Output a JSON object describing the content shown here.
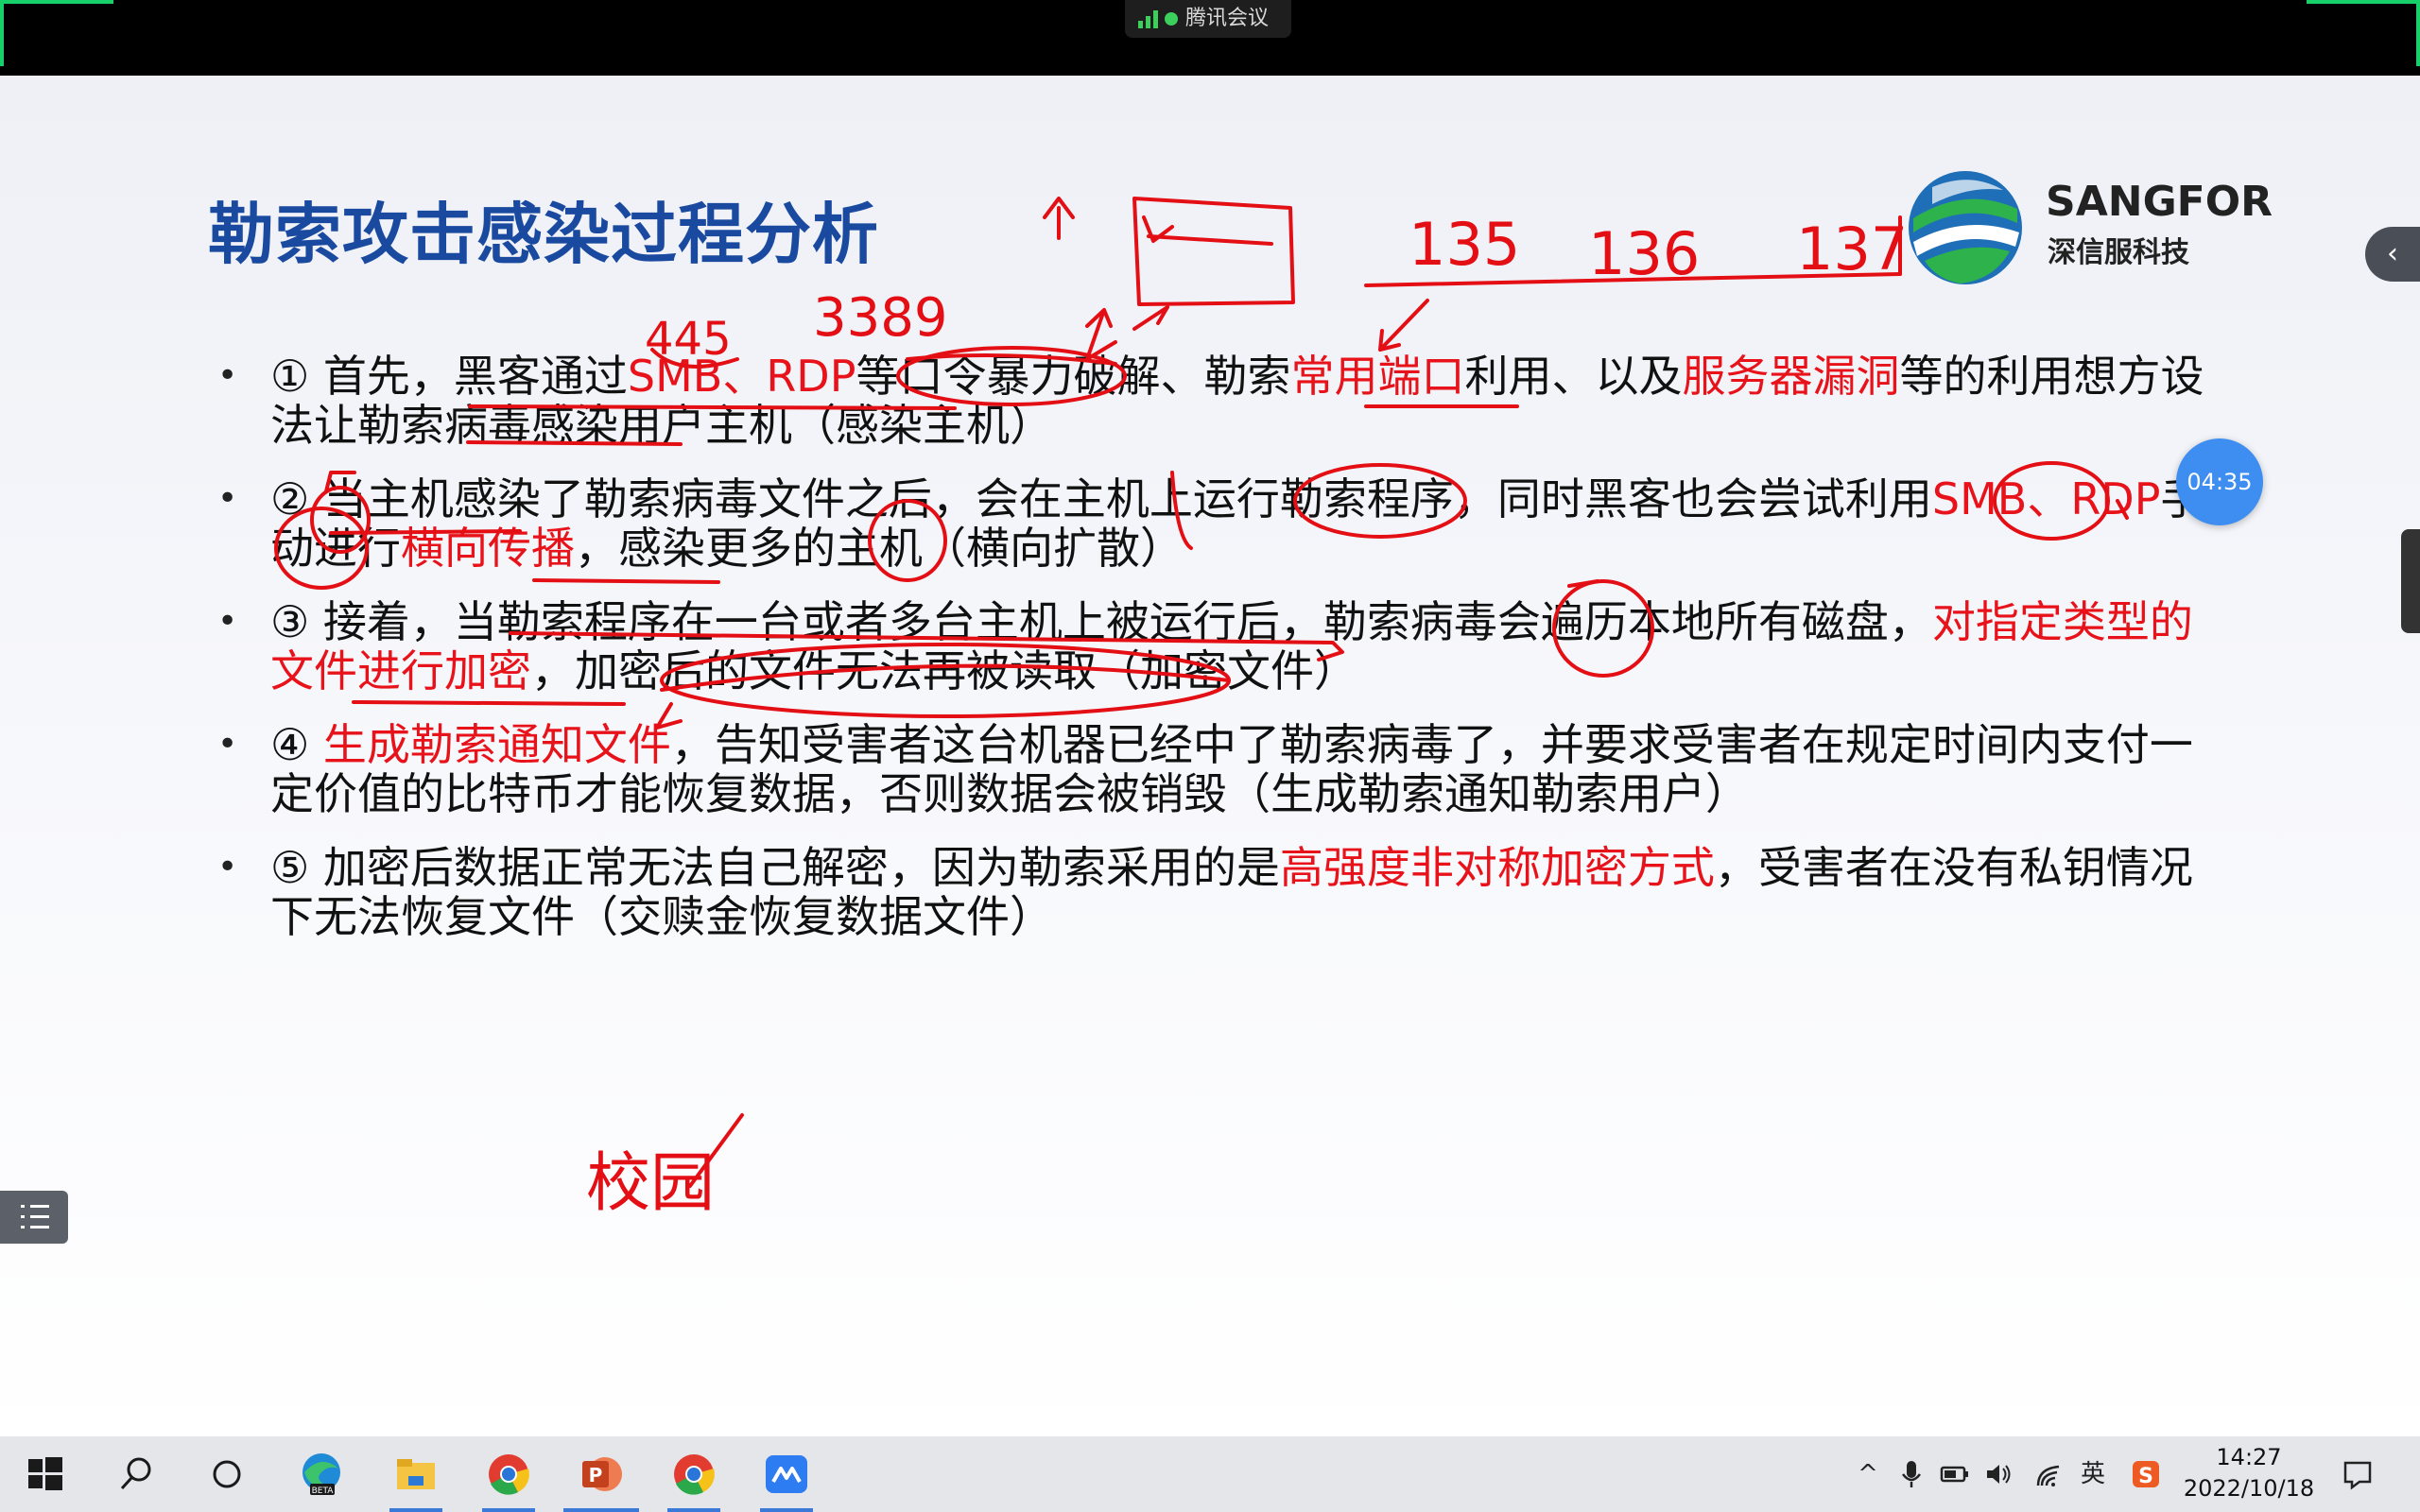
{
  "meeting": {
    "app_name": "腾讯会议"
  },
  "slide": {
    "title": "勒索攻击感染过程分析",
    "logo": {
      "brand": "SANGFOR",
      "brand_cn": "深信服科技"
    },
    "bullets": [
      {
        "parts": [
          {
            "t": "① 首先，黑客通过",
            "c": "black"
          },
          {
            "t": "SMB、RDP",
            "c": "red"
          },
          {
            "t": "等口令暴力破解、勒索",
            "c": "black"
          },
          {
            "t": "常用端口",
            "c": "red"
          },
          {
            "t": "利用、以及",
            "c": "black"
          },
          {
            "t": "服务器漏洞",
            "c": "red"
          },
          {
            "t": "等的利用想方设法让勒索病毒感染用户主机（感染主机）",
            "c": "black"
          }
        ]
      },
      {
        "parts": [
          {
            "t": "② 当主机感染了勒索病毒文件之后，会在主机上运行勒索程序，同时黑客也会尝试利用",
            "c": "black"
          },
          {
            "t": "SMB、RDP",
            "c": "red"
          },
          {
            "t": "手动进行",
            "c": "black"
          },
          {
            "t": "横向传播",
            "c": "red"
          },
          {
            "t": "，感染更多的主机（横向扩散）",
            "c": "black"
          }
        ]
      },
      {
        "parts": [
          {
            "t": "③ 接着，当勒索程序在一台或者多台主机上被运行后，勒索病毒会遍历本地所有磁盘，",
            "c": "black"
          },
          {
            "t": "对指定类型的文件进行加密",
            "c": "red"
          },
          {
            "t": "，加密后的文件无法再被读取（加密文件）",
            "c": "black"
          }
        ]
      },
      {
        "parts": [
          {
            "t": "④ ",
            "c": "black"
          },
          {
            "t": "生成勒索通知文件",
            "c": "red"
          },
          {
            "t": "，告知受害者这台机器已经中了勒索病毒了，并要求受害者在规定时间内支付一定价值的比特币才能恢复数据，否则数据会被销毁（生成勒索通知勒索用户）",
            "c": "black"
          }
        ]
      },
      {
        "parts": [
          {
            "t": "⑤ 加密后数据正常无法自己解密，因为勒索采用的是",
            "c": "black"
          },
          {
            "t": "高强度非对称加密方式",
            "c": "red"
          },
          {
            "t": "，受害者在没有私钥情况下无法恢复文件（交赎金恢复数据文件）",
            "c": "black"
          }
        ]
      }
    ],
    "handwriting": {
      "n445": "445",
      "n3389": "3389",
      "n135": "135",
      "n136": "136",
      "n137": "137",
      "campus": "校园"
    }
  },
  "overlay": {
    "timer": "04:35",
    "side_tab_icon": "‹"
  },
  "taskbar": {
    "apps": [
      "start-icon",
      "search-icon",
      "task-view-icon",
      "edge-beta-icon",
      "file-explorer-icon",
      "chrome-icon",
      "powerpoint-icon",
      "chrome-icon",
      "tencent-meeting-icon"
    ],
    "tray": {
      "ime": "英",
      "time": "14:27",
      "date": "2022/10/18"
    }
  },
  "colors": {
    "title": "#1a4aa0",
    "highlight": "#e8121a",
    "ink": "#e30f14"
  }
}
